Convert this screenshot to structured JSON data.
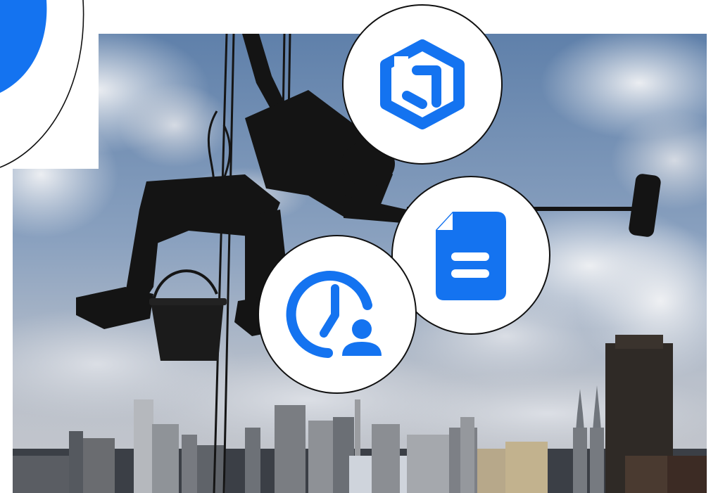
{
  "scene": {
    "description_icons": [
      "hexagon-link-icon",
      "document-icon",
      "clock-user-icon"
    ],
    "photo_subject": "rope-access-window-cleaner-silhouette",
    "colors": {
      "accent": "#1473f0",
      "sky_top": "#6f8fb7",
      "sky_bottom": "#c9cdd6",
      "silhouette": "#141414",
      "badge_border": "#111111",
      "badge_fill": "#ffffff"
    }
  }
}
